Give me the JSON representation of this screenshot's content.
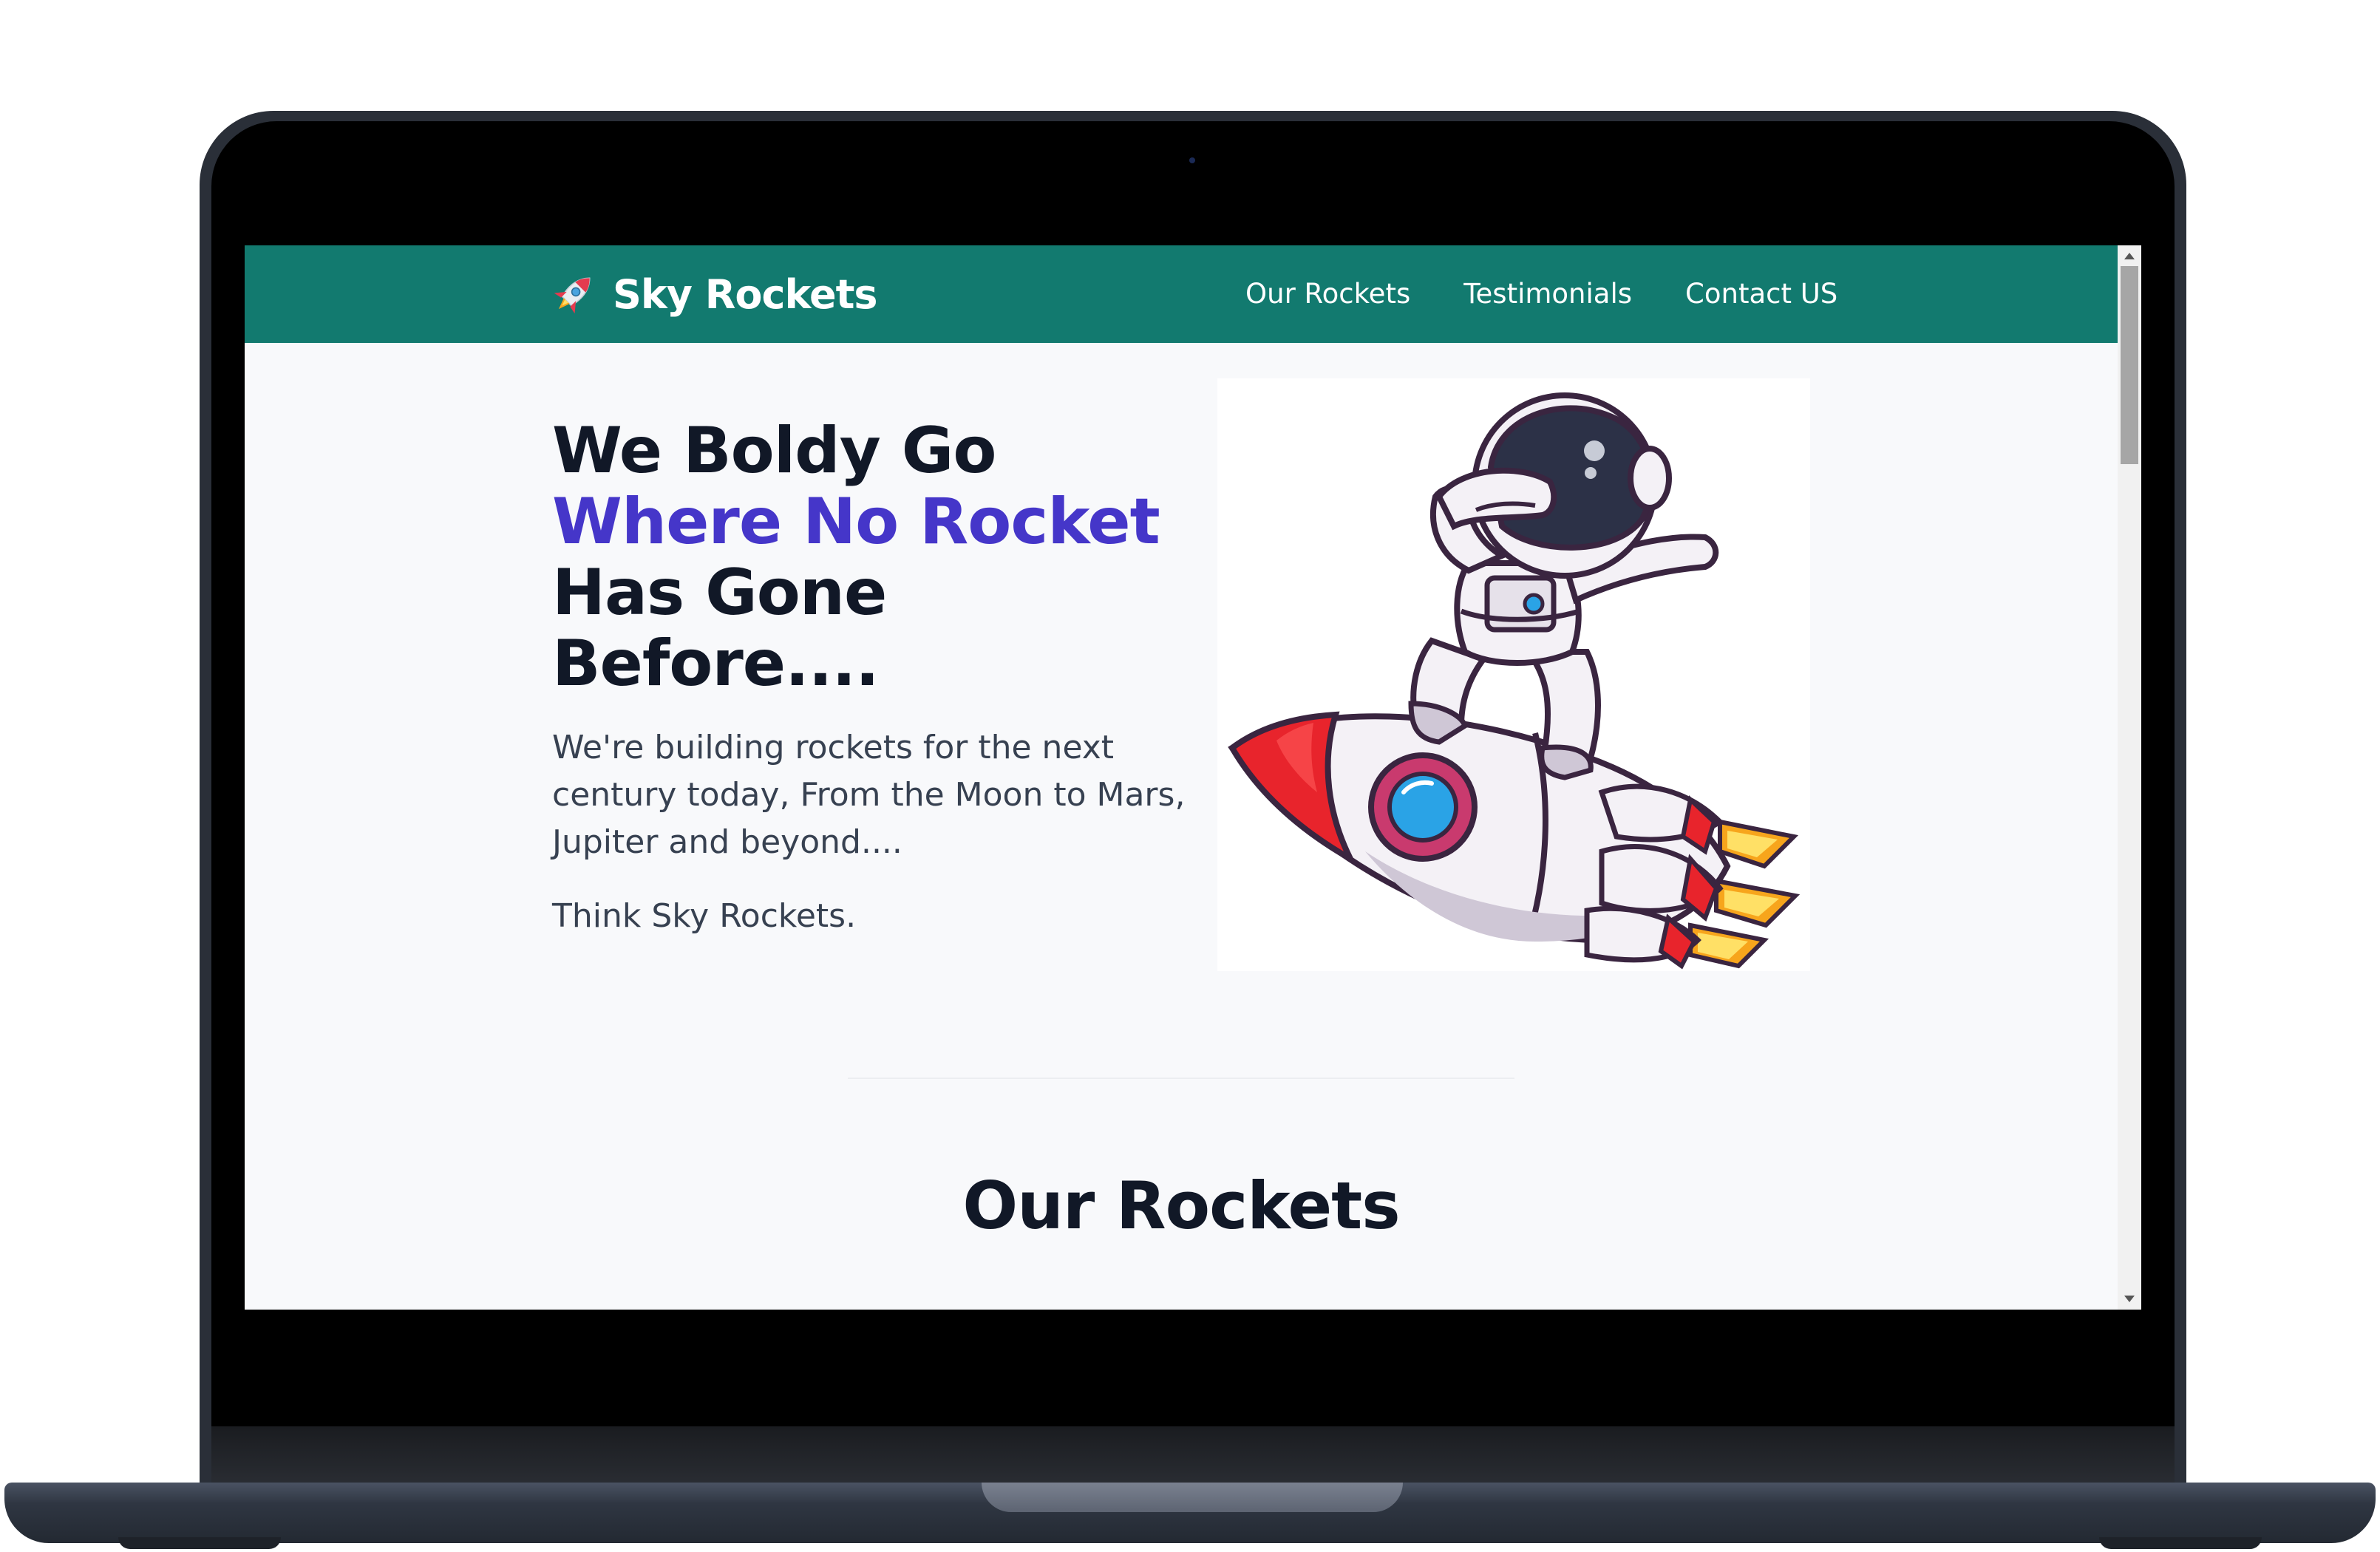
{
  "brand": {
    "name": "Sky Rockets",
    "icon": "rocket-icon"
  },
  "nav": {
    "links": [
      {
        "label": "Our Rockets"
      },
      {
        "label": "Testimonials"
      },
      {
        "label": "Contact US"
      }
    ]
  },
  "hero": {
    "heading_line1": "We Boldy Go",
    "heading_line2": "Where No Rocket",
    "heading_line3": "Has Gone",
    "heading_line4": "Before....",
    "description": "We're building rockets for the next century today, From the Moon to Mars, Jupiter and beyond....",
    "tagline": "Think Sky Rockets.",
    "image": "astronaut-riding-rocket-illustration"
  },
  "sections": {
    "rockets_title": "Our Rockets"
  },
  "colors": {
    "navbar": "#127a6f",
    "accent": "#4536c9",
    "heading": "#111827",
    "body_text": "#374151",
    "page_bg": "#f8f9fb"
  }
}
